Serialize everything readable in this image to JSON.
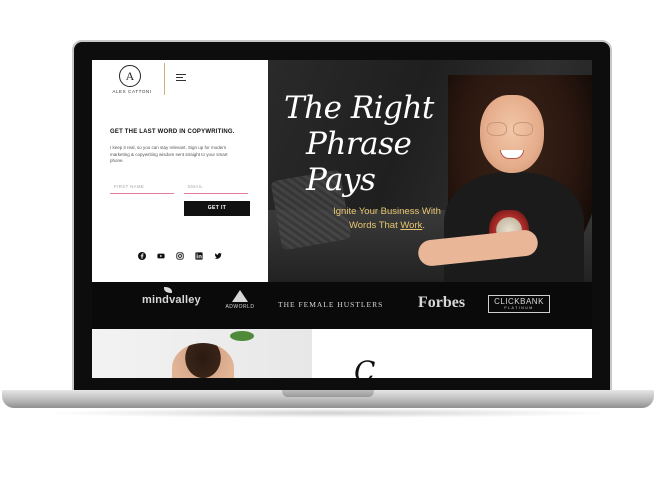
{
  "brand": {
    "logo_letter": "A",
    "logo_name": "ALEX CATTONI"
  },
  "signup": {
    "headline": "GET THE LAST WORD IN COPYWRITING.",
    "blurb": "I keep it real, so you can stay relevant. Sign up for modern marketing & copywriting wisdom sent straight to your smart phone.",
    "first_name_placeholder": "FIRST NAME",
    "email_placeholder": "EMAIL",
    "button_label": "GET IT"
  },
  "social_icons": [
    "facebook-icon",
    "youtube-icon",
    "instagram-icon",
    "linkedin-icon",
    "twitter-icon"
  ],
  "hero": {
    "script_line1": "The Right",
    "script_line2": "Phrase Pays",
    "tagline_line1": "Ignite Your Business With",
    "tagline_line2_prefix": "Words That ",
    "tagline_line2_link": "Work",
    "tagline_line2_suffix": "."
  },
  "featured_logos": {
    "mindvalley": "mindvalley",
    "adworld": "ADWORLD",
    "female_hustlers": "THE FEMALE HUSTLERS",
    "forbes": "Forbes",
    "clickbank": "CLICKBANK",
    "clickbank_sub": "PLATINUM"
  },
  "lower_section": {
    "script_fragment": "C"
  },
  "colors": {
    "accent_gold": "#e8c670",
    "field_underline": "#e07aa0",
    "button_bg": "#111111",
    "strip_bg": "#0a0a0a"
  }
}
